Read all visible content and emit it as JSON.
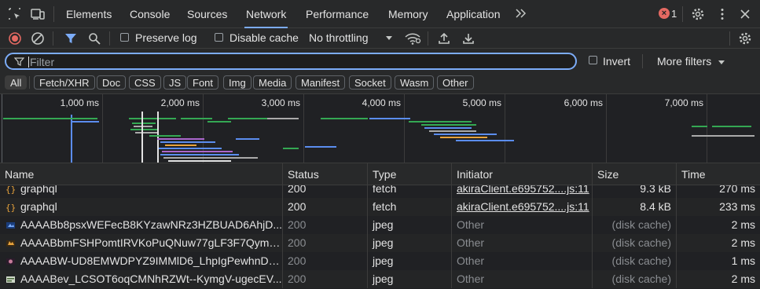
{
  "tabs": [
    {
      "label": "Elements"
    },
    {
      "label": "Console"
    },
    {
      "label": "Sources"
    },
    {
      "label": "Network",
      "active": true
    },
    {
      "label": "Performance"
    },
    {
      "label": "Memory"
    },
    {
      "label": "Application"
    }
  ],
  "error_count": "1",
  "toolbar": {
    "preserve_log": "Preserve log",
    "disable_cache": "Disable cache",
    "throttling": "No throttling"
  },
  "filter": {
    "placeholder": "Filter",
    "invert_label": "Invert",
    "more_filters": "More filters"
  },
  "type_filters": [
    "All",
    "Fetch/XHR",
    "Doc",
    "CSS",
    "JS",
    "Font",
    "Img",
    "Media",
    "Manifest",
    "Socket",
    "Wasm",
    "Other"
  ],
  "overview": {
    "ticks": [
      "1,000 ms",
      "2,000 ms",
      "3,000 ms",
      "4,000 ms",
      "5,000 ms",
      "6,000 ms",
      "7,000 ms"
    ]
  },
  "columns": {
    "name": "Name",
    "status": "Status",
    "type": "Type",
    "initiator": "Initiator",
    "size": "Size",
    "time": "Time"
  },
  "rows": [
    {
      "name": "graphql",
      "status": "200",
      "type": "fetch",
      "initiator": "akiraClient.e695752....js:11",
      "size": "9.3 kB",
      "time": "270 ms",
      "icon": "fetch-icon"
    },
    {
      "name": "graphql",
      "status": "200",
      "type": "fetch",
      "initiator": "akiraClient.e695752....js:11",
      "size": "8.4 kB",
      "time": "233 ms",
      "icon": "fetch-icon"
    },
    {
      "name": "AAAABb8psxWEFecB8KYzawNRz3HZBUAD6AhjD...",
      "status": "200",
      "type": "jpeg",
      "initiator": "Other",
      "size": "(disk cache)",
      "time": "2 ms",
      "icon": "image-thumbnail-icon"
    },
    {
      "name": "AAAABbmFSHPomtIRVKoPuQNuw77gLF3F7QymA...",
      "status": "200",
      "type": "jpeg",
      "initiator": "Other",
      "size": "(disk cache)",
      "time": "2 ms",
      "icon": "image-thumbnail-icon"
    },
    {
      "name": "AAAABW-UD8EMWDPYZ9IMMlD6_LhpIgPewhnDU...",
      "status": "200",
      "type": "jpeg",
      "initiator": "Other",
      "size": "(disk cache)",
      "time": "1 ms",
      "icon": "image-thumbnail-icon"
    },
    {
      "name": "AAAABev_LCSOT6oqCMNhRZWt--KymgV-ugecEV...",
      "status": "200",
      "type": "jpeg",
      "initiator": "Other",
      "size": "(disk cache)",
      "time": "2 ms",
      "icon": "image-thumbnail-icon"
    }
  ],
  "colors": {
    "accent": "#7cacf8",
    "record": "#e46962",
    "error": "#e46962"
  }
}
